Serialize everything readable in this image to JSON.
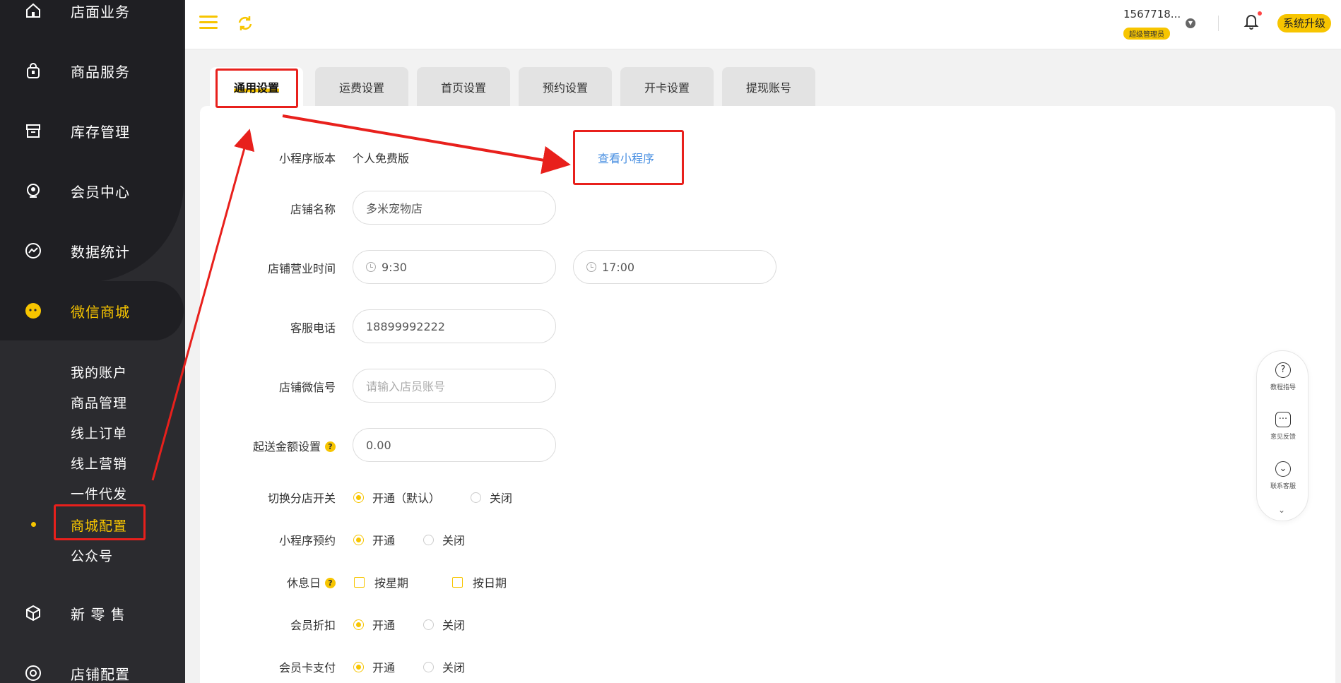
{
  "sidebar": {
    "items": [
      {
        "label": "店面业务",
        "icon": "home-icon"
      },
      {
        "label": "商品服务",
        "icon": "bag-icon"
      },
      {
        "label": "库存管理",
        "icon": "archive-icon"
      },
      {
        "label": "会员中心",
        "icon": "member-icon"
      },
      {
        "label": "数据统计",
        "icon": "chart-icon"
      },
      {
        "label": "微信商城",
        "icon": "wechat-icon"
      },
      {
        "label": "新 零 售",
        "icon": "box-icon"
      },
      {
        "label": "店铺配置",
        "icon": "settings-icon"
      }
    ],
    "sub_items": [
      "我的账户",
      "商品管理",
      "线上订单",
      "线上营销",
      "一件代发",
      "商城配置",
      "公众号"
    ]
  },
  "topbar": {
    "user_name": "1567718...",
    "user_role": "超级管理员",
    "upgrade_label": "系统升级"
  },
  "tabs": [
    "通用设置",
    "运费设置",
    "首页设置",
    "预约设置",
    "开卡设置",
    "提现账号"
  ],
  "form": {
    "mini_version_label": "小程序版本",
    "mini_version_value": "个人免费版",
    "view_mini_link": "查看小程序",
    "shop_name_label": "店铺名称",
    "shop_name_value": "多米宠物店",
    "hours_label": "店铺营业时间",
    "hours_open": "9:30",
    "hours_close": "17:00",
    "phone_label": "客服电话",
    "phone_value": "18899992222",
    "wechat_label": "店铺微信号",
    "wechat_placeholder": "请输入店员账号",
    "min_amount_label": "起送金额设置",
    "min_amount_value": "0.00",
    "help_mark": "?",
    "branch_switch_label": "切换分店开关",
    "branch_on": "开通（默认）",
    "branch_off": "关闭",
    "mini_booking_label": "小程序预约",
    "booking_on": "开通",
    "booking_off": "关闭",
    "rest_day_label": "休息日",
    "rest_by_week": "按星期",
    "rest_by_date": "按日期",
    "member_discount_label": "会员折扣",
    "discount_on": "开通",
    "discount_off": "关闭",
    "card_pay_label": "会员卡支付",
    "card_pay_on": "开通",
    "card_pay_off": "关闭"
  },
  "float_panel": {
    "items": [
      "教程指导",
      "意见反馈",
      "联系客服"
    ]
  },
  "colors": {
    "accent": "#f7c500",
    "sidebar_bg": "#2b2b2f",
    "link": "#4a90e2",
    "annotation": "#e8201c"
  }
}
